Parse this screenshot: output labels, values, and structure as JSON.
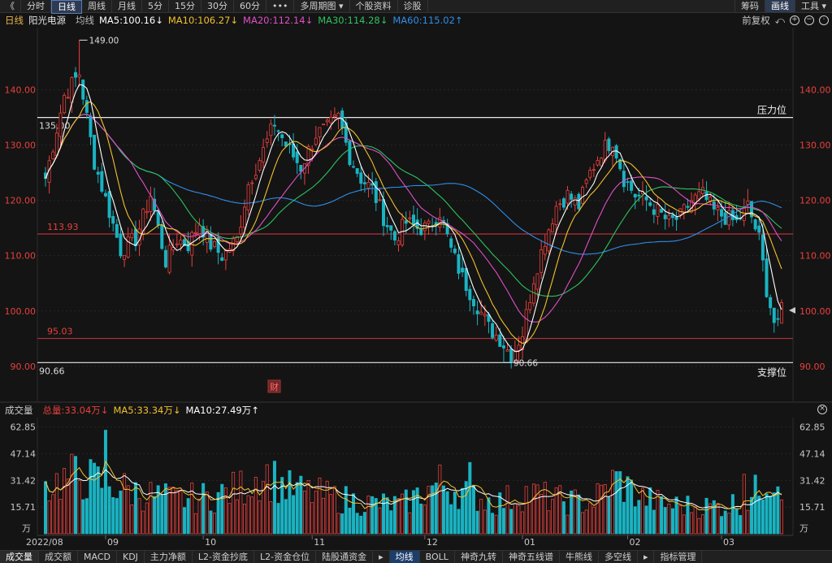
{
  "toolbar": {
    "back": "《",
    "items": [
      "分时",
      "日线",
      "周线",
      "月线",
      "5分",
      "15分",
      "30分",
      "60分",
      "•••",
      "多周期图 ▾",
      "个股资料",
      "诊股"
    ],
    "active_index": 1,
    "right": [
      "筹码",
      "画线",
      "工具 ▾"
    ]
  },
  "info": {
    "period": "日线",
    "stock_name": "阳光电源",
    "ma_label": "均线",
    "ma5": "MA5:100.16↓",
    "ma10": "MA10:106.27↓",
    "ma20": "MA20:112.14↓",
    "ma30": "MA30:114.28↓",
    "ma60": "MA60:115.02↑",
    "adjust": "前复权"
  },
  "volume_info": {
    "label": "成交量",
    "total": "总量:33.04万↓",
    "ma5": "MA5:33.34万↓",
    "ma10": "MA10:27.49万↑"
  },
  "colors": {
    "up": "#e8403d",
    "down": "#1ab3c2",
    "ma5": "#ffffff",
    "ma10": "#f2c12e",
    "ma20": "#e04fc6",
    "ma30": "#2ec25e",
    "ma60": "#2f8ee8",
    "axis": "#e8403d"
  },
  "price_axis": {
    "labels": [
      "140.00",
      "130.00",
      "120.00",
      "110.00",
      "100.00",
      "90.00"
    ],
    "values": [
      140,
      130,
      120,
      110,
      100,
      90
    ],
    "min": 90,
    "max": 150
  },
  "annotations": {
    "high_label": "149.00",
    "low_label": "90.66",
    "resistance_value": "135.00",
    "resistance_label": "压力位",
    "support_value": "90.66",
    "support_label": "支撑位",
    "line_113": "113.93",
    "line_95": "95.03",
    "news_marker": "财"
  },
  "volume_axis": {
    "labels": [
      "62.85",
      "47.14",
      "31.42",
      "15.71"
    ],
    "values": [
      62.85,
      47.14,
      31.42,
      15.71
    ],
    "unit": "万",
    "max": 67
  },
  "x_axis": [
    "2022/08",
    "09",
    "10",
    "11",
    "12",
    "01",
    "02",
    "03"
  ],
  "chart_data": {
    "type": "candlestick",
    "title": "阳光电源 日线",
    "series_names": [
      "MA5",
      "MA10",
      "MA20",
      "MA30",
      "MA60"
    ],
    "resistance": 135.0,
    "support": 90.66,
    "lines": [
      113.93,
      95.03
    ],
    "period_high": 149.0,
    "period_low": 90.66,
    "control_points": [
      [
        0,
        124
      ],
      [
        5,
        139
      ],
      [
        9,
        143
      ],
      [
        13,
        127
      ],
      [
        17,
        118
      ],
      [
        20,
        111
      ],
      [
        24,
        113
      ],
      [
        28,
        121
      ],
      [
        32,
        109
      ],
      [
        35,
        113
      ],
      [
        38,
        112
      ],
      [
        41,
        116
      ],
      [
        44,
        112
      ],
      [
        47,
        110
      ],
      [
        51,
        113
      ],
      [
        54,
        123
      ],
      [
        58,
        129
      ],
      [
        61,
        134
      ],
      [
        64,
        130
      ],
      [
        68,
        126
      ],
      [
        72,
        132
      ],
      [
        75,
        133
      ],
      [
        78,
        135
      ],
      [
        81,
        128
      ],
      [
        84,
        124
      ],
      [
        87,
        122
      ],
      [
        90,
        117
      ],
      [
        93,
        113
      ],
      [
        96,
        116
      ],
      [
        99,
        115
      ],
      [
        102,
        115
      ],
      [
        105,
        118
      ],
      [
        108,
        111
      ],
      [
        111,
        106
      ],
      [
        115,
        101
      ],
      [
        118,
        97
      ],
      [
        121,
        95
      ],
      [
        124,
        92
      ],
      [
        127,
        96
      ],
      [
        130,
        106
      ],
      [
        133,
        113
      ],
      [
        136,
        119
      ],
      [
        139,
        121
      ],
      [
        142,
        119
      ],
      [
        145,
        125
      ],
      [
        148,
        129
      ],
      [
        151,
        131
      ],
      [
        154,
        124
      ],
      [
        157,
        121
      ],
      [
        160,
        120
      ],
      [
        163,
        118
      ],
      [
        166,
        116
      ],
      [
        169,
        117
      ],
      [
        172,
        120
      ],
      [
        175,
        121
      ],
      [
        178,
        118
      ],
      [
        181,
        117
      ],
      [
        184,
        116
      ],
      [
        187,
        119
      ],
      [
        190,
        113
      ],
      [
        192,
        104
      ],
      [
        194,
        98
      ],
      [
        195,
        97
      ],
      [
        196,
        101
      ]
    ],
    "volume_control_points": [
      [
        0,
        28
      ],
      [
        8,
        34
      ],
      [
        15,
        30
      ],
      [
        25,
        24
      ],
      [
        35,
        20
      ],
      [
        45,
        22
      ],
      [
        52,
        27
      ],
      [
        58,
        36
      ],
      [
        65,
        26
      ],
      [
        75,
        22
      ],
      [
        85,
        18
      ],
      [
        95,
        17
      ],
      [
        105,
        30
      ],
      [
        112,
        24
      ],
      [
        120,
        18
      ],
      [
        128,
        24
      ],
      [
        136,
        20
      ],
      [
        145,
        18
      ],
      [
        152,
        32
      ],
      [
        158,
        22
      ],
      [
        165,
        17
      ],
      [
        175,
        16
      ],
      [
        182,
        17
      ],
      [
        188,
        21
      ],
      [
        192,
        34
      ],
      [
        196,
        33
      ]
    ],
    "month_start_index": [
      0,
      16,
      42,
      71,
      101,
      127,
      155,
      180
    ]
  },
  "bottom_tabs": [
    "成交量",
    "成交额",
    "MACD",
    "KDJ",
    "主力净额",
    "L2-资金抄底",
    "L2-资金仓位",
    "陆股通资金",
    "▸",
    "均线",
    "BOLL",
    "神奇九转",
    "神奇五线谱",
    "牛熊线",
    "多空线",
    "▸",
    "指标管理"
  ],
  "bottom_active": 0,
  "bottom_blue": 9
}
